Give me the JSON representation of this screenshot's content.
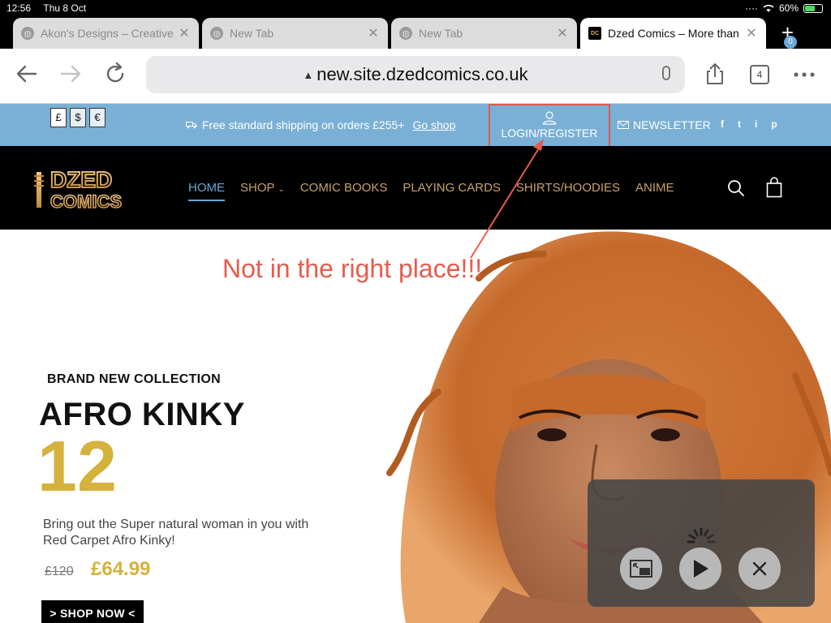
{
  "status_bar": {
    "time": "12:56",
    "date": "Thu 8 Oct",
    "battery": "60%",
    "battery_level": 0.6
  },
  "tabs": [
    {
      "title": "Akon's Designs – Creative",
      "favicon": "globe-icon",
      "active": false
    },
    {
      "title": "New Tab",
      "favicon": "globe-icon",
      "active": false
    },
    {
      "title": "New Tab",
      "favicon": "globe-icon",
      "active": false
    },
    {
      "title": "Dzed Comics – More than",
      "favicon": "DC",
      "active": true
    }
  ],
  "toolbar": {
    "url": "new.site.dzedcomics.co.uk",
    "tab_count": "4"
  },
  "topbar": {
    "currencies": [
      "£",
      "$",
      "€"
    ],
    "shipping_text": "Free standard shipping on orders £255+",
    "shipping_link": "Go shop",
    "login": "LOGIN/REGISTER",
    "newsletter": "NEWSLETTER",
    "socials": [
      "f",
      "t",
      "i",
      "p"
    ]
  },
  "header": {
    "logo_line1": "DZED",
    "logo_line2": "COMICS",
    "nav": [
      "HOME",
      "SHOP",
      "COMIC BOOKS",
      "PLAYING CARDS",
      "SHIRTS/HOODIES",
      "ANIME"
    ],
    "active_nav": "HOME",
    "cart_count": "0"
  },
  "hero": {
    "kicker": "BRAND NEW COLLECTION",
    "title": "AFRO KINKY",
    "number": "12",
    "description": "Bring out the Super natural woman in you with Red Carpet Afro Kinky!",
    "price_old": "£120",
    "price_new": "£64.99",
    "cta": "> SHOP NOW <"
  },
  "annotation": {
    "text": "Not in the right place!!!"
  },
  "colors": {
    "topbar": "#7ab0d6",
    "accent_gold": "#d4b23c",
    "nav_gold": "#c8a26a",
    "annotation_red": "#e95b4c"
  }
}
